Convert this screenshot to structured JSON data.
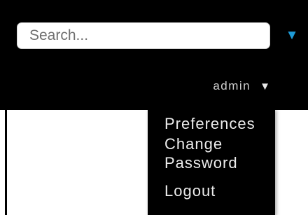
{
  "search": {
    "placeholder": "Search...",
    "value": ""
  },
  "search_dropdown": {
    "icon": "triangle-down-icon",
    "glyph": "▼",
    "color": "#1e9bd7"
  },
  "user_menu": {
    "username": "admin",
    "caret_glyph": "▼",
    "expanded": true,
    "items": [
      {
        "label_line1": "Preferences"
      },
      {
        "label_line1": "Change",
        "label_line2": "Password"
      },
      {
        "label_line1": "Logout"
      }
    ]
  },
  "colors": {
    "header_background": "#000000",
    "accent": "#1e9bd7",
    "menu_text": "#ececec"
  }
}
